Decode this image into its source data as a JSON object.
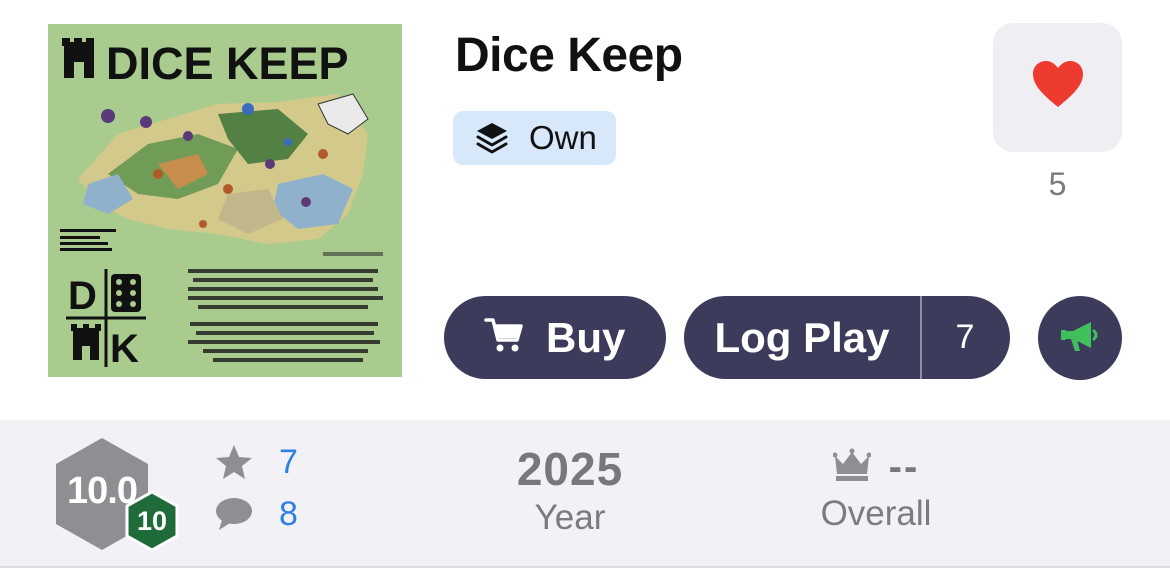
{
  "game": {
    "title": "Dice Keep",
    "ownership_label": "Own"
  },
  "cover": {
    "logo_text": "DICE KEEP",
    "tiles": [
      "D",
      "K"
    ]
  },
  "favorite": {
    "icon": "heart-icon",
    "count": "5"
  },
  "actions": {
    "buy_label": "Buy",
    "log_play_label": "Log Play",
    "log_play_count": "7"
  },
  "stats": {
    "rating": "10.0",
    "rank_badge": "10",
    "ratings_count": "7",
    "comments_count": "8",
    "year": "2025",
    "year_label": "Year",
    "overall_rank": "--",
    "overall_label": "Overall"
  },
  "colors": {
    "button_bg": "#3d3b5c",
    "badge_bg": "#d7e8fb",
    "heart": "#ee3b30",
    "rank_green": "#1f6b3a",
    "link_blue": "#2f7fe0",
    "megaphone_green": "#3fc05a"
  }
}
